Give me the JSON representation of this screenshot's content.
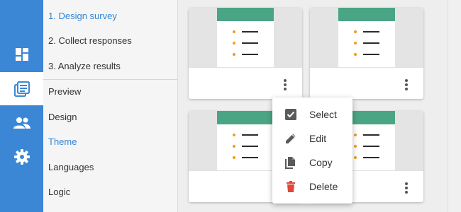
{
  "rail": {
    "items": [
      {
        "name": "dashboard-icon",
        "active": false
      },
      {
        "name": "surveys-icon",
        "active": true
      },
      {
        "name": "users-icon",
        "active": false
      },
      {
        "name": "settings-icon",
        "active": false
      }
    ]
  },
  "nav": {
    "steps": [
      {
        "label": "1. Design survey",
        "active": true
      },
      {
        "label": "2. Collect responses",
        "active": false
      },
      {
        "label": "3. Analyze results",
        "active": false
      }
    ],
    "items": [
      {
        "label": "Preview",
        "active": false
      },
      {
        "label": "Design",
        "active": false
      },
      {
        "label": "Theme",
        "active": true
      },
      {
        "label": "Languages",
        "active": false
      },
      {
        "label": "Logic",
        "active": false
      }
    ]
  },
  "menu": {
    "items": [
      {
        "label": "Select",
        "icon": "checkbox-icon"
      },
      {
        "label": "Edit",
        "icon": "pencil-icon"
      },
      {
        "label": "Copy",
        "icon": "copy-icon"
      },
      {
        "label": "Delete",
        "icon": "trash-icon"
      }
    ]
  },
  "colors": {
    "rail": "#3b87d6",
    "accent": "#2f86d6",
    "theme_header": "#4aa584",
    "bullet": "#f29b1d",
    "delete": "#e0463a"
  }
}
